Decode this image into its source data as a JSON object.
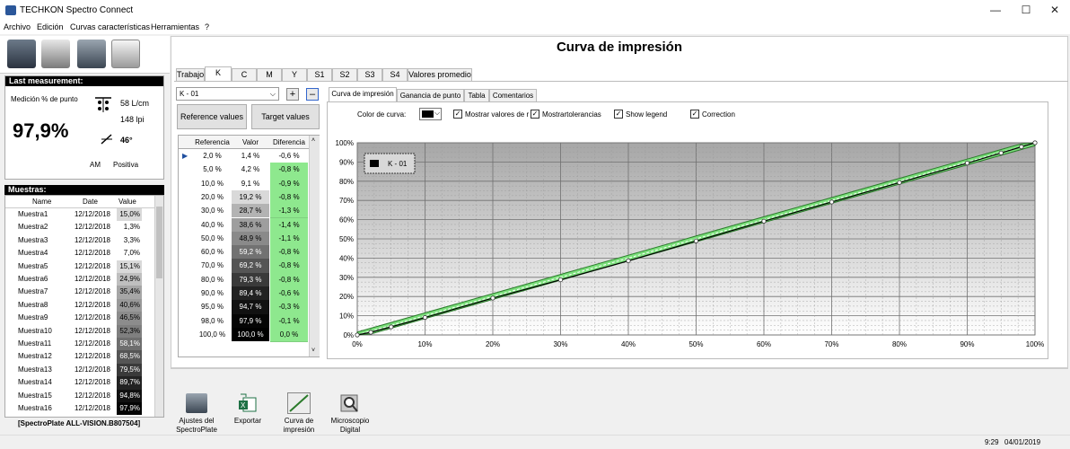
{
  "window": {
    "title": "TECHKON Spectro Connect",
    "minimize": "—",
    "maximize": "☐",
    "close": "✕"
  },
  "menu": [
    "Archivo",
    "Edición",
    "Curvas características",
    "Herramientas",
    "?"
  ],
  "last_measurement": {
    "header": "Last measurement:",
    "label": "Medición % de punto",
    "value": "97,9%",
    "lpcm": "58 L/cm",
    "lpi": "148 lpi",
    "angle": "46°",
    "am": "AM",
    "polarity": "Positiva"
  },
  "samples": {
    "header": "Muestras:",
    "columns": [
      "Name",
      "Date",
      "Value"
    ],
    "rows": [
      {
        "name": "Muestra1",
        "date": "12/12/2018",
        "value": "15,0%",
        "shade": "#d9d9d9",
        "dark": false
      },
      {
        "name": "Muestra2",
        "date": "12/12/2018",
        "value": "1,3%",
        "shade": "#ffffff",
        "dark": false
      },
      {
        "name": "Muestra3",
        "date": "12/12/2018",
        "value": "3,3%",
        "shade": "#ffffff",
        "dark": false
      },
      {
        "name": "Muestra4",
        "date": "12/12/2018",
        "value": "7,0%",
        "shade": "#ffffff",
        "dark": false
      },
      {
        "name": "Muestra5",
        "date": "12/12/2018",
        "value": "15,1%",
        "shade": "#d9d9d9",
        "dark": false
      },
      {
        "name": "Muestra6",
        "date": "12/12/2018",
        "value": "24,9%",
        "shade": "#bfbfbf",
        "dark": false
      },
      {
        "name": "Muestra7",
        "date": "12/12/2018",
        "value": "35,4%",
        "shade": "#a6a6a6",
        "dark": false
      },
      {
        "name": "Muestra8",
        "date": "12/12/2018",
        "value": "40,6%",
        "shade": "#999999",
        "dark": false
      },
      {
        "name": "Muestra9",
        "date": "12/12/2018",
        "value": "46,5%",
        "shade": "#8c8c8c",
        "dark": false
      },
      {
        "name": "Muestra10",
        "date": "12/12/2018",
        "value": "52,3%",
        "shade": "#7f7f7f",
        "dark": false
      },
      {
        "name": "Muestra11",
        "date": "12/12/2018",
        "value": "58,1%",
        "shade": "#6e6e6e",
        "dark": true
      },
      {
        "name": "Muestra12",
        "date": "12/12/2018",
        "value": "68,5%",
        "shade": "#555555",
        "dark": true
      },
      {
        "name": "Muestra13",
        "date": "12/12/2018",
        "value": "79,5%",
        "shade": "#3a3a3a",
        "dark": true
      },
      {
        "name": "Muestra14",
        "date": "12/12/2018",
        "value": "89,7%",
        "shade": "#222222",
        "dark": true
      },
      {
        "name": "Muestra15",
        "date": "12/12/2018",
        "value": "94,8%",
        "shade": "#111111",
        "dark": true
      },
      {
        "name": "Muestra16",
        "date": "12/12/2018",
        "value": "97,9%",
        "shade": "#050505",
        "dark": true
      }
    ],
    "footer": "[SpectroPlate ALL-VISION.B807504]"
  },
  "main": {
    "title": "Curva de impresión",
    "tabs": [
      "Trabajo",
      "K",
      "C",
      "M",
      "Y",
      "S1",
      "S2",
      "S3",
      "S4",
      "Valores promedio"
    ],
    "active_tab": 1,
    "curve_select": "K - 01",
    "plus": "+",
    "minus": "–",
    "reference_btn": "Reference values",
    "target_btn": "Target values",
    "table_headers": [
      "Referencia",
      "Valor",
      "Diferencia"
    ],
    "table_rows": [
      {
        "ref": "2,0 %",
        "val": "1,4 %",
        "dif": "-0,6 %",
        "shade": "#ffffff",
        "dark": false,
        "green": false
      },
      {
        "ref": "5,0 %",
        "val": "4,2 %",
        "dif": "-0,8 %",
        "shade": "#ffffff",
        "dark": false,
        "green": true
      },
      {
        "ref": "10,0 %",
        "val": "9,1 %",
        "dif": "-0,9 %",
        "shade": "#ffffff",
        "dark": false,
        "green": true
      },
      {
        "ref": "20,0 %",
        "val": "19,2 %",
        "dif": "-0,8 %",
        "shade": "#d9d9d9",
        "dark": false,
        "green": true
      },
      {
        "ref": "30,0 %",
        "val": "28,7 %",
        "dif": "-1,3 %",
        "shade": "#b3b3b3",
        "dark": false,
        "green": true
      },
      {
        "ref": "40,0 %",
        "val": "38,6 %",
        "dif": "-1,4 %",
        "shade": "#9e9e9e",
        "dark": false,
        "green": true
      },
      {
        "ref": "50,0 %",
        "val": "48,9 %",
        "dif": "-1,1 %",
        "shade": "#8a8a8a",
        "dark": false,
        "green": true
      },
      {
        "ref": "60,0 %",
        "val": "59,2 %",
        "dif": "-0,8 %",
        "shade": "#727272",
        "dark": true,
        "green": true
      },
      {
        "ref": "70,0 %",
        "val": "69,2 %",
        "dif": "-0,8 %",
        "shade": "#555555",
        "dark": true,
        "green": true
      },
      {
        "ref": "80,0 %",
        "val": "79,3 %",
        "dif": "-0,8 %",
        "shade": "#3a3a3a",
        "dark": true,
        "green": true
      },
      {
        "ref": "90,0 %",
        "val": "89,4 %",
        "dif": "-0,6 %",
        "shade": "#222222",
        "dark": true,
        "green": true
      },
      {
        "ref": "95,0 %",
        "val": "94,7 %",
        "dif": "-0,3 %",
        "shade": "#111111",
        "dark": true,
        "green": true
      },
      {
        "ref": "98,0 %",
        "val": "97,9 %",
        "dif": "-0,1 %",
        "shade": "#050505",
        "dark": true,
        "green": true
      },
      {
        "ref": "100,0 %",
        "val": "100,0 %",
        "dif": "0,0 %",
        "shade": "#000000",
        "dark": true,
        "green": true
      }
    ],
    "sub_tabs": [
      "Curva de impresión",
      "Ganancia de punto",
      "Tabla",
      "Comentarios"
    ],
    "active_sub_tab": 0,
    "options": {
      "color_label": "Color de curva:",
      "show_values": "Mostrar valores de r",
      "show_tolerances": "Mostrartolerancias",
      "show_legend": "Show legend",
      "correction": "Correction"
    }
  },
  "chart_data": {
    "type": "line",
    "xlim": [
      0,
      100
    ],
    "ylim": [
      0,
      100
    ],
    "x_ticks": [
      "0%",
      "10%",
      "20%",
      "30%",
      "40%",
      "50%",
      "60%",
      "70%",
      "80%",
      "90%",
      "100%"
    ],
    "y_ticks": [
      "0%",
      "10%",
      "20%",
      "30%",
      "40%",
      "50%",
      "60%",
      "70%",
      "80%",
      "90%",
      "100%"
    ],
    "grid": true,
    "legend": "top-left",
    "series": [
      {
        "name": "K - 01",
        "x": [
          0,
          2,
          5,
          10,
          20,
          30,
          40,
          50,
          60,
          70,
          80,
          90,
          95,
          98,
          100
        ],
        "y": [
          0,
          1.4,
          4.2,
          9.1,
          19.2,
          28.7,
          38.6,
          48.9,
          59.2,
          69.2,
          79.3,
          89.4,
          94.7,
          97.9,
          100
        ]
      }
    ],
    "reference": {
      "x": [
        0,
        2,
        5,
        10,
        20,
        30,
        40,
        50,
        60,
        70,
        80,
        90,
        95,
        98,
        100
      ],
      "y": [
        0,
        2,
        5,
        10,
        20,
        30,
        40,
        50,
        60,
        70,
        80,
        90,
        95,
        98,
        100
      ]
    },
    "tolerance": 1.5,
    "colors": {
      "curve": "#000000",
      "band": "#7de07d",
      "band_edge": "#2a7a2a"
    }
  },
  "bottom_tools": [
    {
      "label1": "Ajustes del",
      "label2": "SpectroPlate"
    },
    {
      "label1": "Exportar",
      "label2": ""
    },
    {
      "label1": "Curva de",
      "label2": "impresión"
    },
    {
      "label1": "Microscopio",
      "label2": "Digital"
    }
  ],
  "status": {
    "time": "9:29",
    "date": "04/01/2019"
  }
}
